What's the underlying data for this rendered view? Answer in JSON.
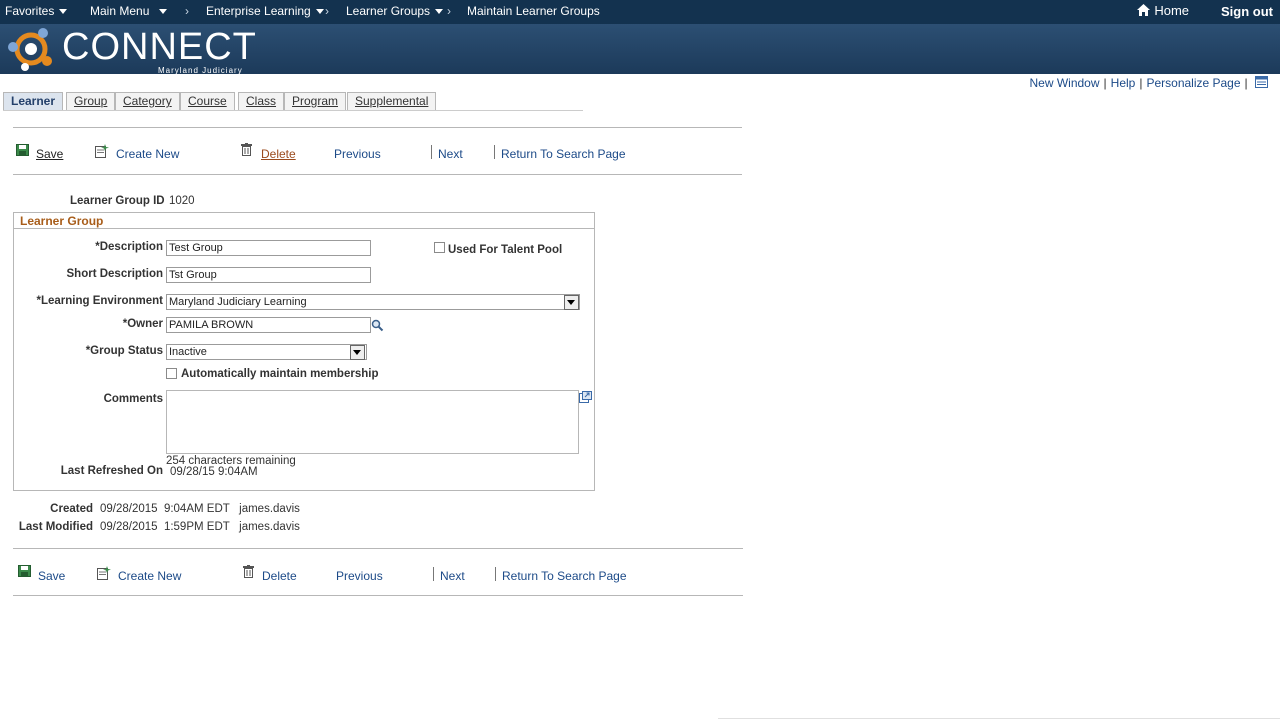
{
  "topnav": {
    "favorites": "Favorites",
    "main_menu": "Main Menu",
    "breadcrumb_1": "Enterprise Learning",
    "breadcrumb_2": "Learner Groups",
    "breadcrumb_3": "Maintain Learner Groups",
    "home": "Home",
    "sign_out": "Sign out",
    "chevron": "›"
  },
  "banner": {
    "logo": "CONNECT",
    "logo_sub": "Maryland Judiciary"
  },
  "toplinks": {
    "new_window": "New Window",
    "help": "Help",
    "personalize": "Personalize Page",
    "sep": "|"
  },
  "tabs": [
    "Learner",
    "Group",
    "Category",
    "Course",
    "Class",
    "Program",
    "Supplemental"
  ],
  "toolbar": {
    "save": "Save",
    "create_new": "Create New",
    "delete": "Delete",
    "previous": "Previous",
    "next": "Next",
    "return": "Return To Search Page"
  },
  "form": {
    "group_id_label": "Learner Group ID",
    "group_id": "1020",
    "section_title": "Learner Group",
    "description_label": "*Description",
    "description": "Test Group",
    "talent_pool_label": "Used For Talent Pool",
    "short_desc_label": "Short Description",
    "short_desc": "Tst Group",
    "learning_env_label": "*Learning Environment",
    "learning_env": "Maryland Judiciary Learning",
    "owner_label": "*Owner",
    "owner": "PAMILA BROWN",
    "status_label": "*Group Status",
    "status": "Inactive",
    "auto_member_label": "Automatically maintain membership",
    "comments_label": "Comments",
    "chars_remaining": "254 characters remaining",
    "last_refreshed_label": "Last Refreshed On",
    "last_refreshed": "09/28/15  9:04AM"
  },
  "audit": {
    "created_label": "Created",
    "created": "09/28/2015  9:04AM EDT   james.davis",
    "modified_label": "Last Modified",
    "modified": "09/28/2015  1:59PM EDT   james.davis"
  },
  "icons": [
    "home-icon",
    "save-icon",
    "create-new-icon",
    "delete-icon",
    "lookup-icon",
    "expand-icon",
    "layout-icon"
  ],
  "colors": {
    "nav_bg": "#13324f",
    "link": "#1c4a88",
    "section_title": "#a85d1a"
  }
}
